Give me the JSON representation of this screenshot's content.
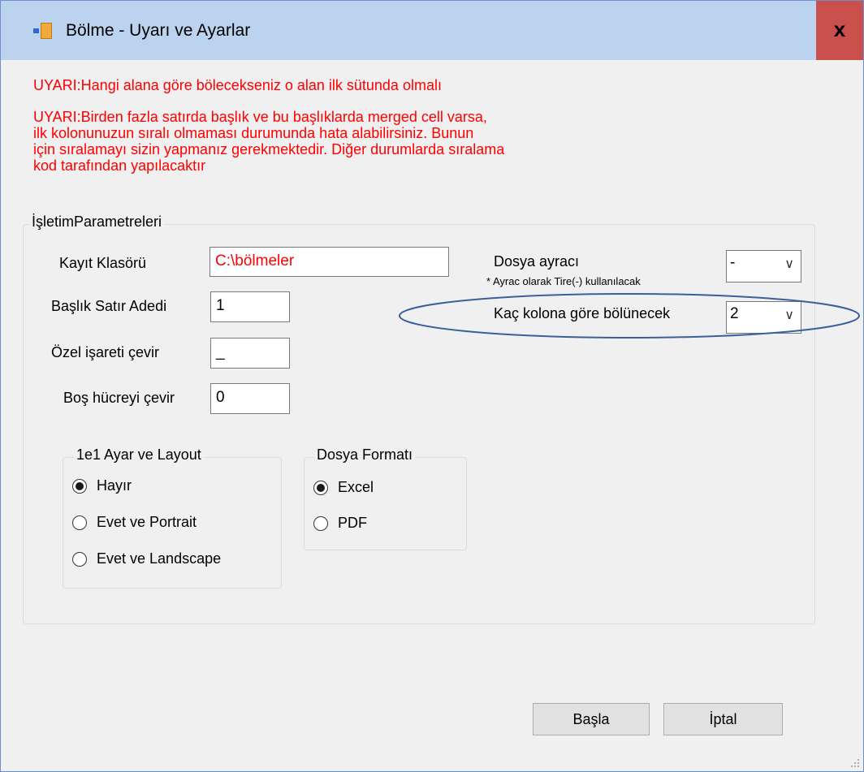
{
  "window": {
    "title": "Bölme - Uyarı ve Ayarlar",
    "close_label": "x"
  },
  "warnings": {
    "line1": "UYARI:Hangi alana göre bölecekseniz o alan ilk sütunda olmalı",
    "line2": "UYARI:Birden fazla satırda başlık ve bu başlıklarda merged cell varsa,\nilk kolonunuzun sıralı olmaması durumunda hata alabilirsiniz. Bunun\niçin sıralamayı sizin yapmanız gerekmektedir. Diğer durumlarda sıralama\nkod tarafından yapılacaktır"
  },
  "params": {
    "legend": "İşletimParametreleri",
    "kayit_label": "Kayıt Klasörü",
    "kayit_value": "C:\\bölmeler",
    "baslik_label": "Başlık Satır Adedi",
    "baslik_value": "1",
    "ozel_label": "Özel işareti çevir",
    "ozel_value": "_",
    "bos_label": "Boş hücreyi çevir",
    "bos_value": "0",
    "ayrac_label": "Dosya ayracı",
    "ayrac_note": "* Ayrac olarak Tire(-) kullanılacak",
    "ayrac_value": "-",
    "kolon_label": "Kaç kolona göre bölünecek",
    "kolon_value": "2"
  },
  "layout_group": {
    "legend": "1e1 Ayar ve Layout",
    "options": [
      "Hayır",
      "Evet ve Portrait",
      "Evet ve Landscape"
    ],
    "selected": "Hayır"
  },
  "format_group": {
    "legend": "Dosya Formatı",
    "options": [
      "Excel",
      "PDF"
    ],
    "selected": "Excel"
  },
  "buttons": {
    "start": "Başla",
    "cancel": "İptal"
  },
  "colors": {
    "titlebar": "#bcd3ef",
    "close": "#c9504d",
    "warning": "#ff0000",
    "highlight_ellipse": "#3a5f9a"
  }
}
